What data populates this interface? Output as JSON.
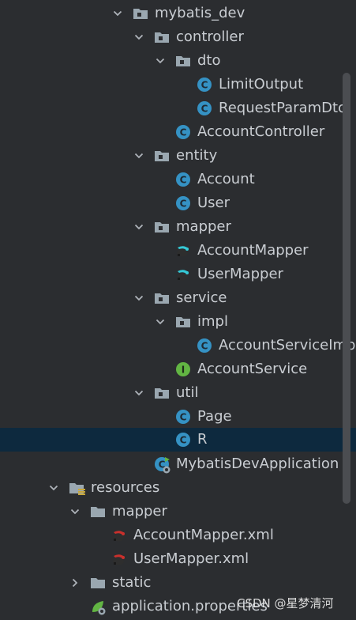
{
  "tree": {
    "items": [
      {
        "label": "mybatis_dev",
        "icon": "package-folder-icon",
        "chevron": "down"
      },
      {
        "label": "controller",
        "icon": "package-folder-icon",
        "chevron": "down"
      },
      {
        "label": "dto",
        "icon": "package-folder-icon",
        "chevron": "down"
      },
      {
        "label": "LimitOutput",
        "icon": "class-icon",
        "chevron": ""
      },
      {
        "label": "RequestParamDto",
        "icon": "class-icon",
        "chevron": ""
      },
      {
        "label": "AccountController",
        "icon": "class-icon",
        "chevron": ""
      },
      {
        "label": "entity",
        "icon": "package-folder-icon",
        "chevron": "down"
      },
      {
        "label": "Account",
        "icon": "class-icon",
        "chevron": ""
      },
      {
        "label": "User",
        "icon": "class-icon",
        "chevron": ""
      },
      {
        "label": "mapper",
        "icon": "package-folder-icon",
        "chevron": "down"
      },
      {
        "label": "AccountMapper",
        "icon": "mybatis-mapper-icon",
        "chevron": ""
      },
      {
        "label": "UserMapper",
        "icon": "mybatis-mapper-icon",
        "chevron": ""
      },
      {
        "label": "service",
        "icon": "package-folder-icon",
        "chevron": "down"
      },
      {
        "label": "impl",
        "icon": "package-folder-icon",
        "chevron": "down"
      },
      {
        "label": "AccountServiceImpl",
        "icon": "class-icon",
        "chevron": ""
      },
      {
        "label": "AccountService",
        "icon": "interface-icon",
        "chevron": ""
      },
      {
        "label": "util",
        "icon": "package-folder-icon",
        "chevron": "down"
      },
      {
        "label": "Page",
        "icon": "class-icon",
        "chevron": ""
      },
      {
        "label": "R",
        "icon": "class-icon",
        "chevron": "",
        "selected": true
      },
      {
        "label": "MybatisDevApplication",
        "icon": "spring-boot-class-icon",
        "chevron": ""
      },
      {
        "label": "resources",
        "icon": "resources-folder-icon",
        "chevron": "down"
      },
      {
        "label": "mapper",
        "icon": "folder-icon",
        "chevron": "down"
      },
      {
        "label": "AccountMapper.xml",
        "icon": "mybatis-xml-icon",
        "chevron": ""
      },
      {
        "label": "UserMapper.xml",
        "icon": "mybatis-xml-icon",
        "chevron": ""
      },
      {
        "label": "static",
        "icon": "folder-icon",
        "chevron": "right"
      },
      {
        "label": "application.properties",
        "icon": "spring-properties-icon",
        "chevron": ""
      }
    ]
  },
  "watermark": "CSDN @星梦清河",
  "colors": {
    "background": "#2b2d30",
    "selection": "#0d293e",
    "text": "#c9cdd2",
    "class_icon": "#3592c4",
    "interface_icon": "#62b543",
    "folder": "#9aa7b0"
  }
}
